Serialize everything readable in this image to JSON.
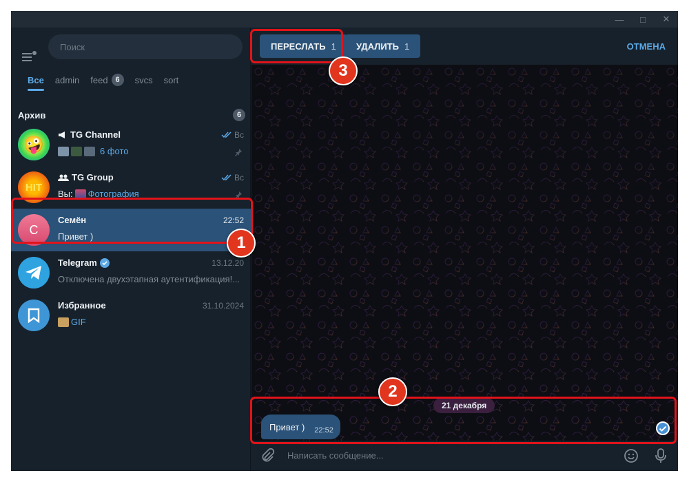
{
  "search": {
    "placeholder": "Поиск"
  },
  "tabs": [
    {
      "label": "Все",
      "active": true
    },
    {
      "label": "admin"
    },
    {
      "label": "feed",
      "badge": "6"
    },
    {
      "label": "svcs"
    },
    {
      "label": "sort"
    }
  ],
  "archive": {
    "label": "Архив",
    "count": "6"
  },
  "chats": [
    {
      "name": "TG Channel",
      "time": "Вс",
      "message": "6 фото",
      "avatar": "🤪"
    },
    {
      "name": "TG Group",
      "time": "Вс",
      "prefix": "Вы:",
      "message": "Фотография",
      "avatar_text": "HIT"
    },
    {
      "name": "Семён",
      "time": "22:52",
      "message": "Привет )",
      "avatar_letter": "С"
    },
    {
      "name": "Telegram",
      "time": "13.12.20",
      "message": "Отключена двухэтапная аутентификация!..."
    },
    {
      "name": "Избранное",
      "time": "31.10.2024",
      "message": "GIF"
    }
  ],
  "toolbar": {
    "forward_label": "ПЕРЕСЛАТЬ",
    "forward_count": "1",
    "delete_label": "УДАЛИТЬ",
    "delete_count": "1",
    "cancel_label": "ОТМЕНА"
  },
  "date_divider": "21 декабря",
  "message": {
    "text": "Привет )",
    "time": "22:52"
  },
  "composer": {
    "placeholder": "Написать сообщение..."
  },
  "steps": [
    "1",
    "2",
    "3"
  ],
  "colors": {
    "sidebar": "#17212b",
    "accent": "#5ca9e6",
    "selected": "#2b5278",
    "annotation": "#e2131a"
  }
}
